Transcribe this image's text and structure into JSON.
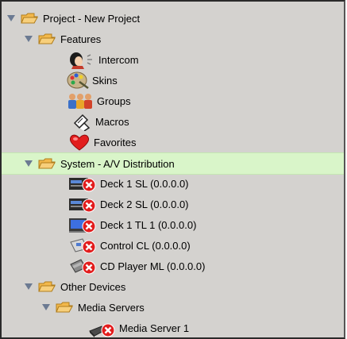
{
  "tree": {
    "project": {
      "label": "Project - New Project"
    },
    "features": {
      "label": "Features",
      "items": [
        {
          "label": "Intercom",
          "icon": "intercom-icon"
        },
        {
          "label": "Skins",
          "icon": "skins-icon"
        },
        {
          "label": "Groups",
          "icon": "groups-icon"
        },
        {
          "label": "Macros",
          "icon": "macros-icon"
        },
        {
          "label": "Favorites",
          "icon": "favorites-icon"
        }
      ]
    },
    "system": {
      "label": "System - A/V Distribution",
      "items": [
        {
          "label": "Deck 1 SL (0.0.0.0)",
          "icon": "deck-icon"
        },
        {
          "label": "Deck 2 SL (0.0.0.0)",
          "icon": "deck-icon"
        },
        {
          "label": "Deck 1 TL 1 (0.0.0.0)",
          "icon": "monitor-deck-icon"
        },
        {
          "label": "Control CL (0.0.0.0)",
          "icon": "control-icon"
        },
        {
          "label": "CD Player ML (0.0.0.0)",
          "icon": "cd-player-icon"
        }
      ]
    },
    "other": {
      "label": "Other Devices"
    },
    "media_servers": {
      "label": "Media Servers",
      "items": [
        {
          "label": "Media Server 1",
          "icon": "media-server-icon"
        }
      ]
    }
  },
  "colors": {
    "selected_row": "#d9f5c9",
    "folder": "#f2b84b",
    "error": "#e21d1d"
  }
}
